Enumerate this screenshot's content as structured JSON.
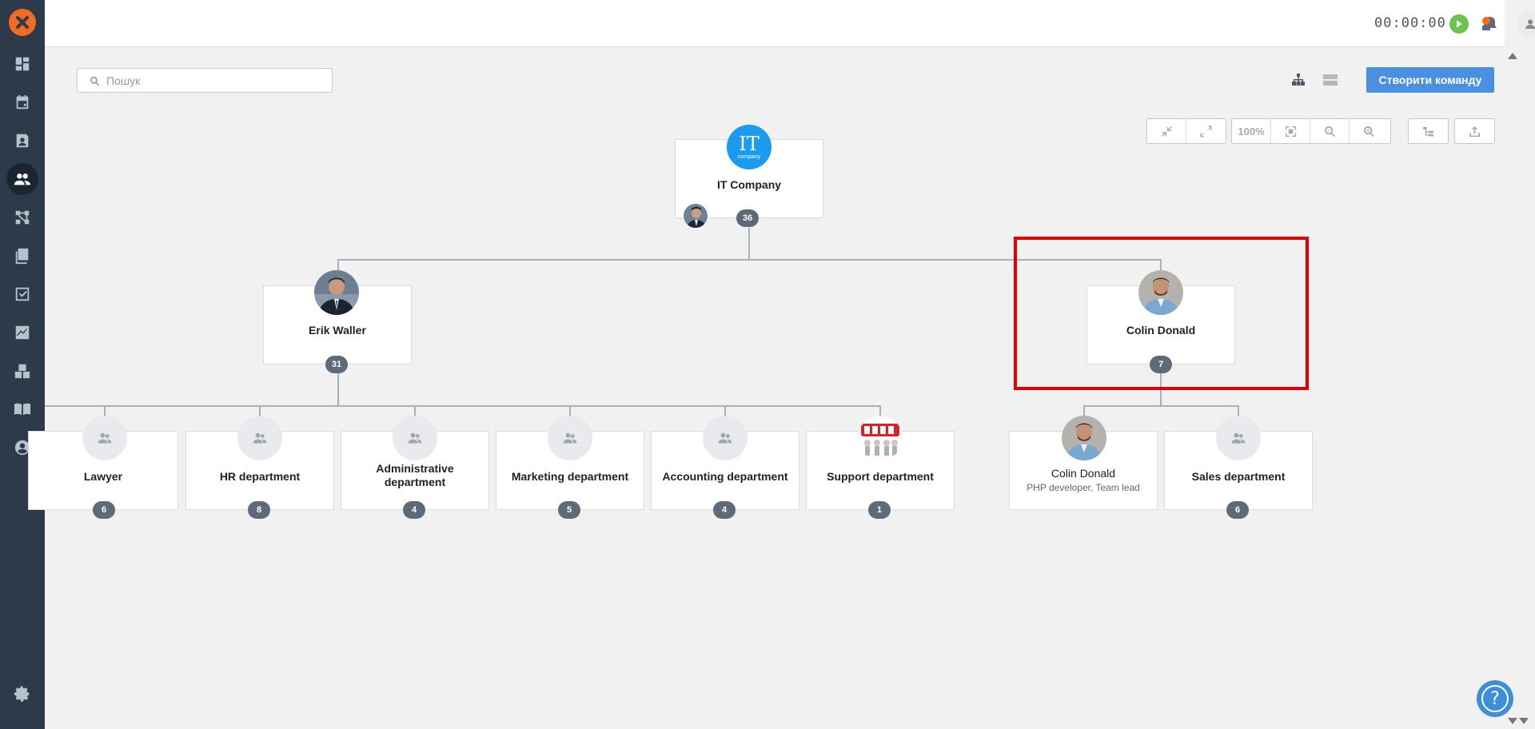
{
  "app": {
    "sidebar_items": [
      {
        "name": "dashboard-icon"
      },
      {
        "name": "calendar-icon"
      },
      {
        "name": "contacts-icon"
      },
      {
        "name": "team-icon",
        "active": true
      },
      {
        "name": "workflow-icon"
      },
      {
        "name": "documents-icon"
      },
      {
        "name": "tasks-icon"
      },
      {
        "name": "reports-icon"
      },
      {
        "name": "warehouse-icon"
      },
      {
        "name": "knowledge-base-icon"
      },
      {
        "name": "profile-icon"
      }
    ],
    "settings_icon": "gear-icon"
  },
  "topbar": {
    "timer": "00:00:00"
  },
  "search": {
    "placeholder": "Пошук",
    "value": ""
  },
  "actions": {
    "create_team_label": "Створити команду"
  },
  "toolbar": {
    "zoom_label": "100%"
  },
  "org_chart": {
    "root": {
      "title": "IT Company",
      "logo_text": "IT",
      "logo_sub": "company",
      "count": "36"
    },
    "level1": [
      {
        "title": "Erik Waller",
        "count": "31"
      },
      {
        "title": "Colin Donald",
        "count": "7"
      }
    ],
    "erik_children": [
      {
        "title": "Lawyer",
        "count": "6"
      },
      {
        "title": "HR department",
        "count": "8"
      },
      {
        "title": "Administrative department",
        "count": "4"
      },
      {
        "title": "Marketing department",
        "count": "5"
      },
      {
        "title": "Accounting department",
        "count": "4"
      },
      {
        "title": "Support department",
        "count": "1"
      }
    ],
    "colin_children": [
      {
        "title": "Colin Donald",
        "subtitle": "PHP developer, Team lead"
      },
      {
        "title": "Sales department",
        "count": "6"
      }
    ]
  },
  "colors": {
    "sidebar": "#2c3a4a",
    "accent": "#4a90e2",
    "logo": "#f26b21",
    "highlight": "#e10000",
    "badge": "#5d6a78"
  }
}
